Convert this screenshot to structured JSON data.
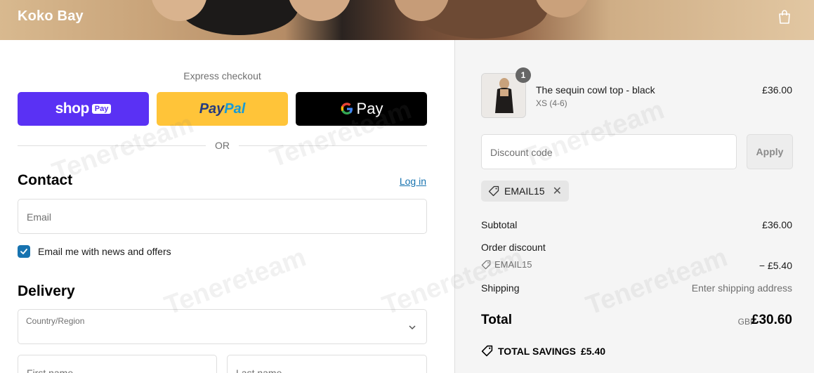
{
  "header": {
    "brand": "Koko Bay",
    "bag_icon": "bag-icon"
  },
  "express": {
    "label": "Express checkout",
    "shop_pay": {
      "word": "shop",
      "badge": "Pay",
      "color": "#5a31f4"
    },
    "paypal": {
      "part1": "Pay",
      "part2": "Pal",
      "color": "#ffc439"
    },
    "gpay": {
      "word": "Pay",
      "color": "#000000"
    }
  },
  "divider": {
    "text": "OR"
  },
  "contact": {
    "title": "Contact",
    "login_link": "Log in",
    "email_placeholder": "Email",
    "newsletter_label": "Email me with news and offers",
    "newsletter_checked": true
  },
  "delivery": {
    "title": "Delivery",
    "country_label": "Country/Region",
    "first_name_placeholder": "First name",
    "last_name_placeholder": "Last name"
  },
  "order": {
    "product": {
      "quantity": "1",
      "name": "The sequin cowl top - black",
      "variant": "XS (4-6)",
      "price": "£36.00"
    },
    "discount": {
      "placeholder": "Discount code",
      "apply_label": "Apply",
      "applied_code": "EMAIL15"
    },
    "summary": {
      "subtotal_label": "Subtotal",
      "subtotal_value": "£36.00",
      "order_discount_label": "Order discount",
      "order_discount_code": "EMAIL15",
      "order_discount_value": "− £5.40",
      "shipping_label": "Shipping",
      "shipping_value": "Enter shipping address",
      "total_label": "Total",
      "total_currency": "GBP",
      "total_value": "£30.60",
      "savings_label": "TOTAL SAVINGS",
      "savings_value": "£5.40"
    }
  },
  "watermark": "Tenereteam",
  "colors": {
    "accent": "#1773b0",
    "sidebar_bg": "#f5f5f5"
  }
}
